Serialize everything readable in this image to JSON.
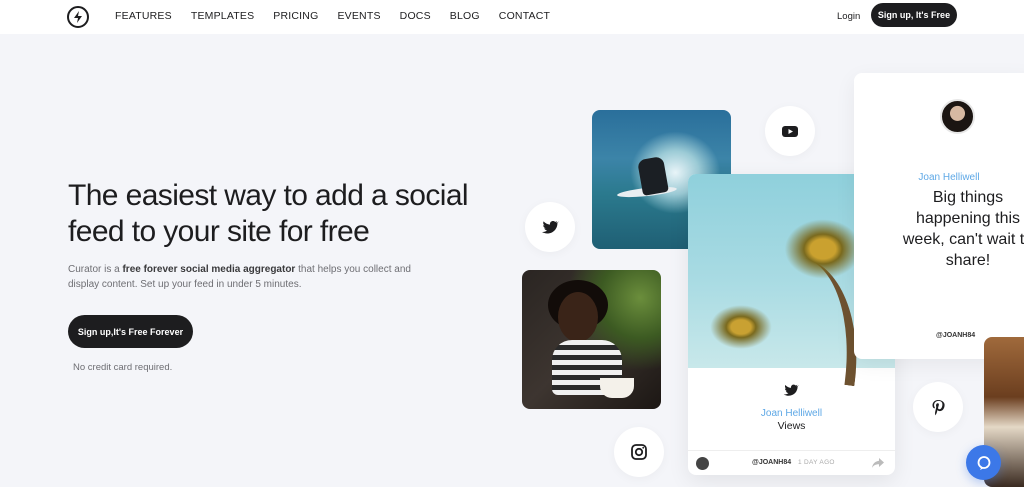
{
  "nav": {
    "links": [
      "FEATURES",
      "TEMPLATES",
      "PRICING",
      "EVENTS",
      "DOCS",
      "BLOG",
      "CONTACT"
    ],
    "login": "Login",
    "cta": "Sign up, It's Free"
  },
  "hero": {
    "title": "The easiest way to add a social feed to your site for free",
    "subtitle_prefix": "Curator is a ",
    "subtitle_bold": "free forever social media aggregator",
    "subtitle_suffix": " that helps you collect and display content. Set up your feed in under 5 minutes.",
    "cta": "Sign up,It's Free Forever",
    "note": "No credit card required."
  },
  "post_card": {
    "name": "Joan Helliwell",
    "text": "Views",
    "handle": "@JOANH84",
    "time": "1 DAY AGO"
  },
  "quote_card": {
    "name": "Joan Helliwell",
    "text": "Big things\nhappening this\nweek, can't wait to\nshare!",
    "handle": "@JOANH84"
  },
  "colors": {
    "accent_blue": "#5ea8e6",
    "dark": "#1d1d1f",
    "background": "#f4f5f9",
    "help": "#3c78e8"
  },
  "icons": [
    "logo-icon",
    "youtube-icon",
    "twitter-icon",
    "instagram-icon",
    "pinterest-icon",
    "share-icon",
    "chat-icon"
  ]
}
